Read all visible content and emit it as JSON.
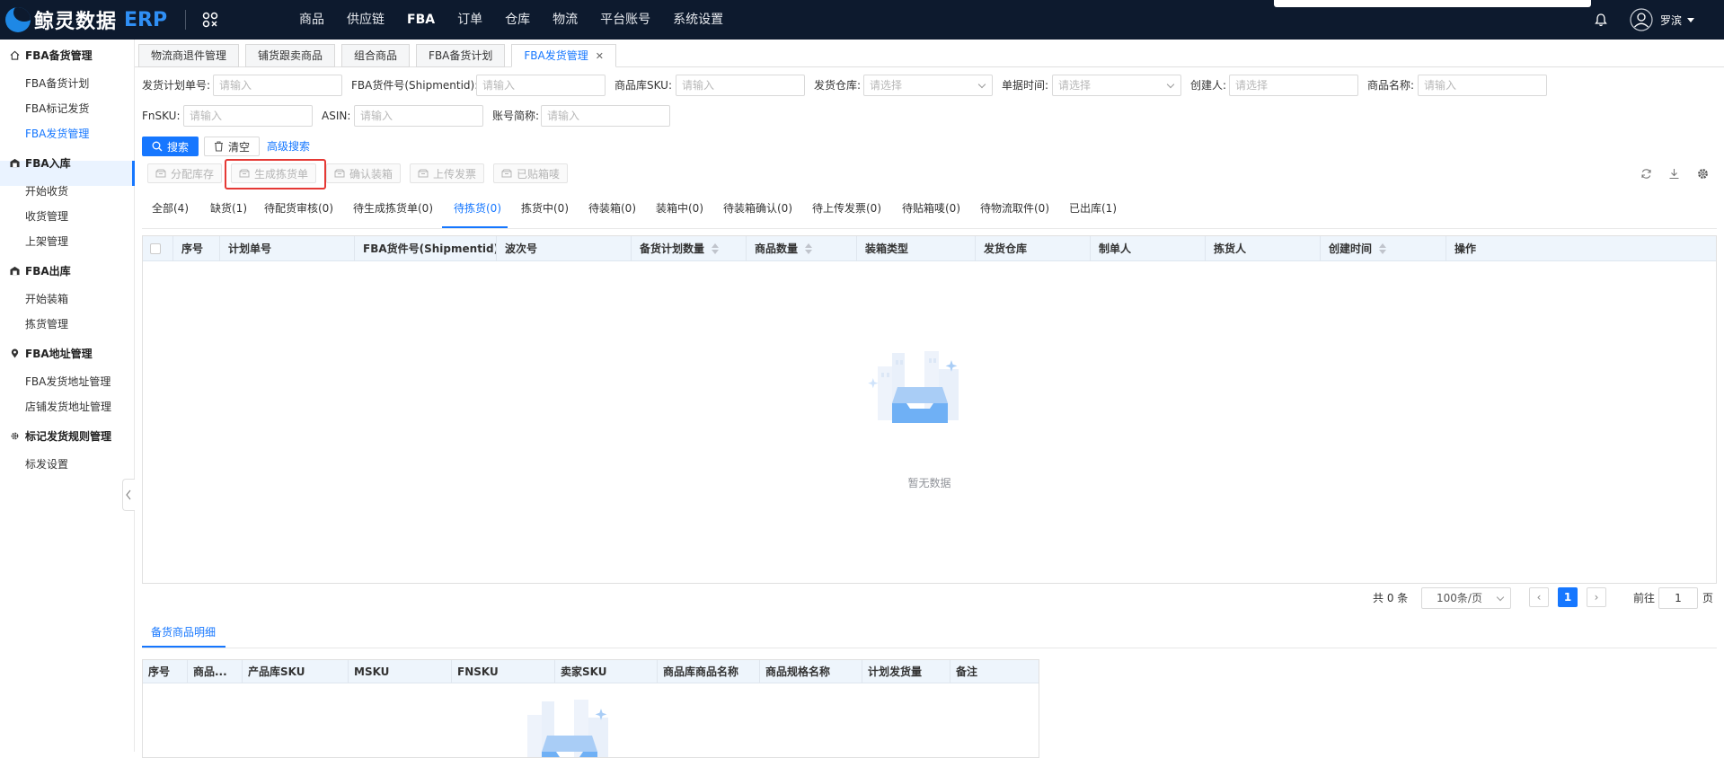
{
  "app": {
    "name": "鲸灵数据",
    "suffix": "ERP",
    "accent": "#1677ff"
  },
  "top_nav": [
    "商品",
    "供应链",
    "FBA",
    "订单",
    "仓库",
    "物流",
    "平台账号",
    "系统设置"
  ],
  "user": {
    "name": "罗滨"
  },
  "sidebar": {
    "groups": [
      {
        "label": "FBA备货管理",
        "icon": "home-icon",
        "items": [
          "FBA备货计划",
          "FBA标记发货",
          "FBA发货管理"
        ]
      },
      {
        "label": "FBA入库",
        "icon": "warehouse-icon",
        "items": [
          "开始收货",
          "收货管理",
          "上架管理"
        ]
      },
      {
        "label": "FBA出库",
        "icon": "warehouse-icon",
        "items": [
          "开始装箱",
          "拣货管理"
        ]
      },
      {
        "label": "FBA地址管理",
        "icon": "location-icon",
        "items": [
          "FBA发货地址管理",
          "店铺发货地址管理"
        ]
      },
      {
        "label": "标记发货规则管理",
        "icon": "gear-icon",
        "items": [
          "标发设置"
        ]
      }
    ],
    "active_item": "FBA发货管理"
  },
  "tabs": [
    {
      "label": "物流商退件管理"
    },
    {
      "label": "铺货跟卖商品"
    },
    {
      "label": "组合商品"
    },
    {
      "label": "FBA备货计划"
    },
    {
      "label": "FBA发货管理",
      "active": true
    }
  ],
  "filters": {
    "plan_no": {
      "label": "发货计划单号:",
      "placeholder": "请输入"
    },
    "shipment_id": {
      "label": "FBA货件号(Shipmentid):",
      "placeholder": "请输入"
    },
    "sku": {
      "label": "商品库SKU:",
      "placeholder": "请输入"
    },
    "warehouse": {
      "label": "发货仓库:",
      "placeholder": "请选择"
    },
    "doc_time": {
      "label": "单据时间:",
      "placeholder": "请选择"
    },
    "creator": {
      "label": "创建人:",
      "placeholder": "请选择"
    },
    "product_name": {
      "label": "商品名称:",
      "placeholder": "请输入"
    },
    "fnsku": {
      "label": "FnSKU:",
      "placeholder": "请输入"
    },
    "asin": {
      "label": "ASIN:",
      "placeholder": "请输入"
    },
    "account": {
      "label": "账号简称:",
      "placeholder": "请输入"
    }
  },
  "buttons": {
    "search": "搜索",
    "clear": "清空",
    "advanced": "高级搜索"
  },
  "actions": [
    "分配库存",
    "生成拣货单",
    "确认装箱",
    "上传发票",
    "已贴箱唛"
  ],
  "status_tabs": [
    "全部(4)",
    "缺货(1)",
    "待配货审核(0)",
    "待生成拣货单(0)",
    "待拣货(0)",
    "拣货中(0)",
    "待装箱(0)",
    "装箱中(0)",
    "待装箱确认(0)",
    "待上传发票(0)",
    "待贴箱唛(0)",
    "待物流取件(0)",
    "已出库(1)"
  ],
  "active_status_tab": "待拣货(0)",
  "table": {
    "columns": [
      "序号",
      "计划单号",
      "FBA货件号(Shipmentid)",
      "波次号",
      "备货计划数量",
      "商品数量",
      "装箱类型",
      "发货仓库",
      "制单人",
      "拣货人",
      "创建时间",
      "操作"
    ],
    "rows": [],
    "empty_text": "暂无数据"
  },
  "pagination": {
    "total": "共 0 条",
    "page_size": "100条/页",
    "current_page": "1",
    "goto_label": "前往",
    "goto_value": "1",
    "goto_suffix": "页"
  },
  "detail": {
    "tab_label": "备货商品明细",
    "columns": [
      "序号",
      "商品...",
      "产品库SKU",
      "MSKU",
      "FNSKU",
      "卖家SKU",
      "商品库商品名称",
      "商品规格名称",
      "计划发货量",
      "备注"
    ]
  }
}
